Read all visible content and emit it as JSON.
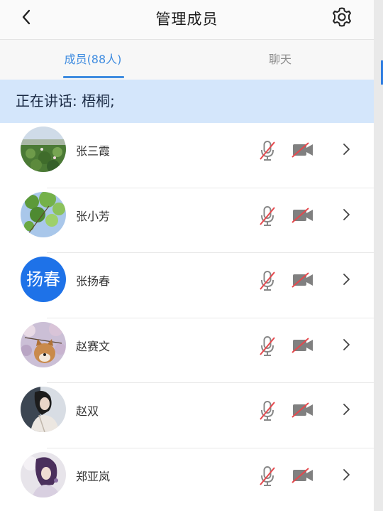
{
  "header": {
    "title": "管理成员",
    "back_icon": "chevron-left-icon",
    "settings_icon": "gear-icon"
  },
  "tabs": [
    {
      "label": "成员(88人)",
      "active": true
    },
    {
      "label": "聊天",
      "active": false
    }
  ],
  "speaking": {
    "text": "正在讲话: 梧桐;"
  },
  "colors": {
    "accent": "#3f8ce0",
    "banner": "#d4e6fb",
    "muted_red": "#e5484d",
    "avatar_blue": "#1e72e8"
  },
  "members": [
    {
      "name": "张三霞",
      "avatar": "lotus-photo"
    },
    {
      "name": "张小芳",
      "avatar": "leaves-photo"
    },
    {
      "name": "张扬春",
      "avatar_text": "扬春"
    },
    {
      "name": "赵赛文",
      "avatar": "dog-photo"
    },
    {
      "name": "赵双",
      "avatar": "woman-photo"
    },
    {
      "name": "郑亚岚",
      "avatar": "woman-photo-2"
    }
  ]
}
